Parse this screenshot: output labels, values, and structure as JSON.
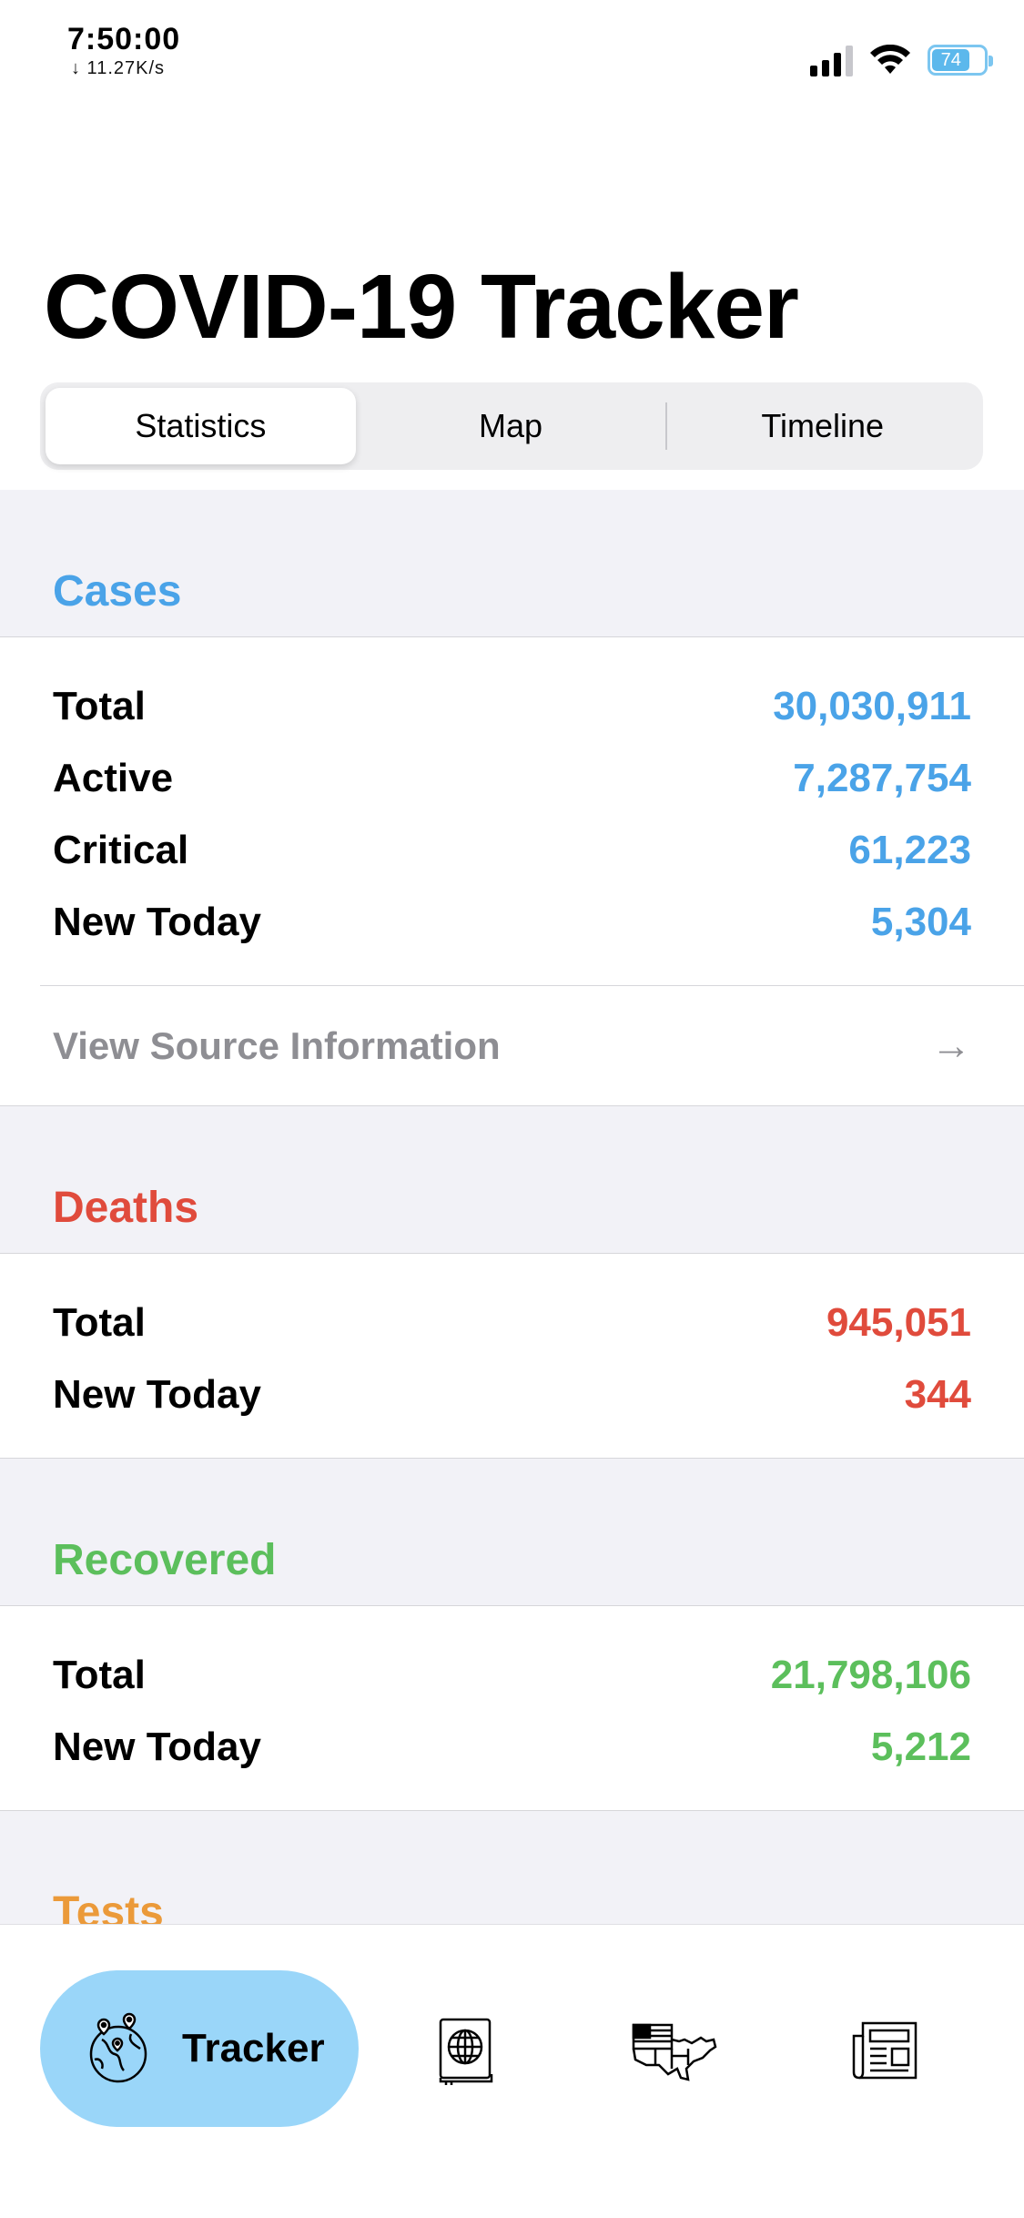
{
  "status_bar": {
    "time": "7:50:00",
    "speed": "↓ 11.27K/s",
    "battery": "74",
    "battery_fraction": 0.74
  },
  "title": "COVID-19 Tracker",
  "segments": [
    {
      "label": "Statistics",
      "active": true
    },
    {
      "label": "Map",
      "active": false
    },
    {
      "label": "Timeline",
      "active": false
    }
  ],
  "colors": {
    "cases": "#4aa3e8",
    "deaths": "#e04b3c",
    "recovered": "#5cbf5c",
    "tests": "#eb9a3a",
    "tab_active": "#9ad6f9"
  },
  "cases": {
    "header": "Cases",
    "rows": [
      {
        "label": "Total",
        "value": "30,030,911"
      },
      {
        "label": "Active",
        "value": "7,287,754"
      },
      {
        "label": "Critical",
        "value": "61,223"
      },
      {
        "label": "New Today",
        "value": "5,304"
      }
    ],
    "source_label": "View Source Information",
    "source_arrow": "→"
  },
  "deaths": {
    "header": "Deaths",
    "rows": [
      {
        "label": "Total",
        "value": "945,051"
      },
      {
        "label": "New Today",
        "value": "344"
      }
    ]
  },
  "recovered": {
    "header": "Recovered",
    "rows": [
      {
        "label": "Total",
        "value": "21,798,106"
      },
      {
        "label": "New Today",
        "value": "5,212"
      }
    ]
  },
  "tests": {
    "header": "Tests"
  },
  "tab_bar": {
    "active_label": "Tracker",
    "icons": [
      "globe-pins-icon",
      "globe-book-icon",
      "usa-map-icon",
      "newspaper-icon"
    ]
  }
}
